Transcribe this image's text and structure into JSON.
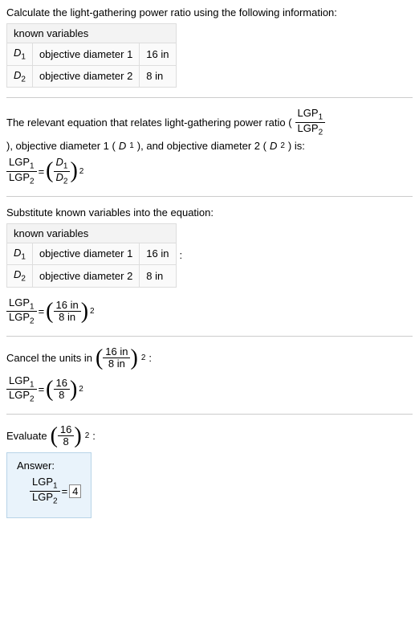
{
  "step1": {
    "intro": "Calculate the light-gathering power ratio using the following information:",
    "table": {
      "header": "known variables",
      "rows": [
        {
          "sym": "D",
          "sub": "1",
          "desc": "objective diameter 1",
          "val": "16 in"
        },
        {
          "sym": "D",
          "sub": "2",
          "desc": "objective diameter 2",
          "val": "8 in"
        }
      ]
    }
  },
  "step2": {
    "text_a": "The relevant equation that relates light-gathering power ratio (",
    "ratio_num": "LGP",
    "ratio_num_sub": "1",
    "ratio_den": "LGP",
    "ratio_den_sub": "2",
    "text_b": "), objective diameter 1 (",
    "d1_sym": "D",
    "d1_sub": "1",
    "text_c": "), and objective diameter 2 (",
    "d2_sym": "D",
    "d2_sub": "2",
    "text_d": ") is:",
    "eq": {
      "lhs_num": "LGP",
      "lhs_num_sub": "1",
      "lhs_den": "LGP",
      "lhs_den_sub": "2",
      "rhs_num": "D",
      "rhs_num_sub": "1",
      "rhs_den": "D",
      "rhs_den_sub": "2",
      "exp": "2"
    }
  },
  "step3": {
    "intro": "Substitute known variables into the equation:",
    "table": {
      "header": "known variables",
      "rows": [
        {
          "sym": "D",
          "sub": "1",
          "desc": "objective diameter 1",
          "val": "16 in"
        },
        {
          "sym": "D",
          "sub": "2",
          "desc": "objective diameter 2",
          "val": "8 in"
        }
      ]
    },
    "colon": ":",
    "eq": {
      "lhs_num": "LGP",
      "lhs_num_sub": "1",
      "lhs_den": "LGP",
      "lhs_den_sub": "2",
      "rhs_num": "16 in",
      "rhs_den": "8 in",
      "exp": "2"
    }
  },
  "step4": {
    "text_a": "Cancel the units in ",
    "inline_num": "16 in",
    "inline_den": "8 in",
    "inline_exp": "2",
    "text_b": ":",
    "eq": {
      "lhs_num": "LGP",
      "lhs_num_sub": "1",
      "lhs_den": "LGP",
      "lhs_den_sub": "2",
      "rhs_num": "16",
      "rhs_den": "8",
      "exp": "2"
    }
  },
  "step5": {
    "text_a": "Evaluate ",
    "inline_num": "16",
    "inline_den": "8",
    "inline_exp": "2",
    "text_b": ":",
    "answer_label": "Answer:",
    "eq": {
      "lhs_num": "LGP",
      "lhs_num_sub": "1",
      "lhs_den": "LGP",
      "lhs_den_sub": "2",
      "result": "4"
    }
  }
}
